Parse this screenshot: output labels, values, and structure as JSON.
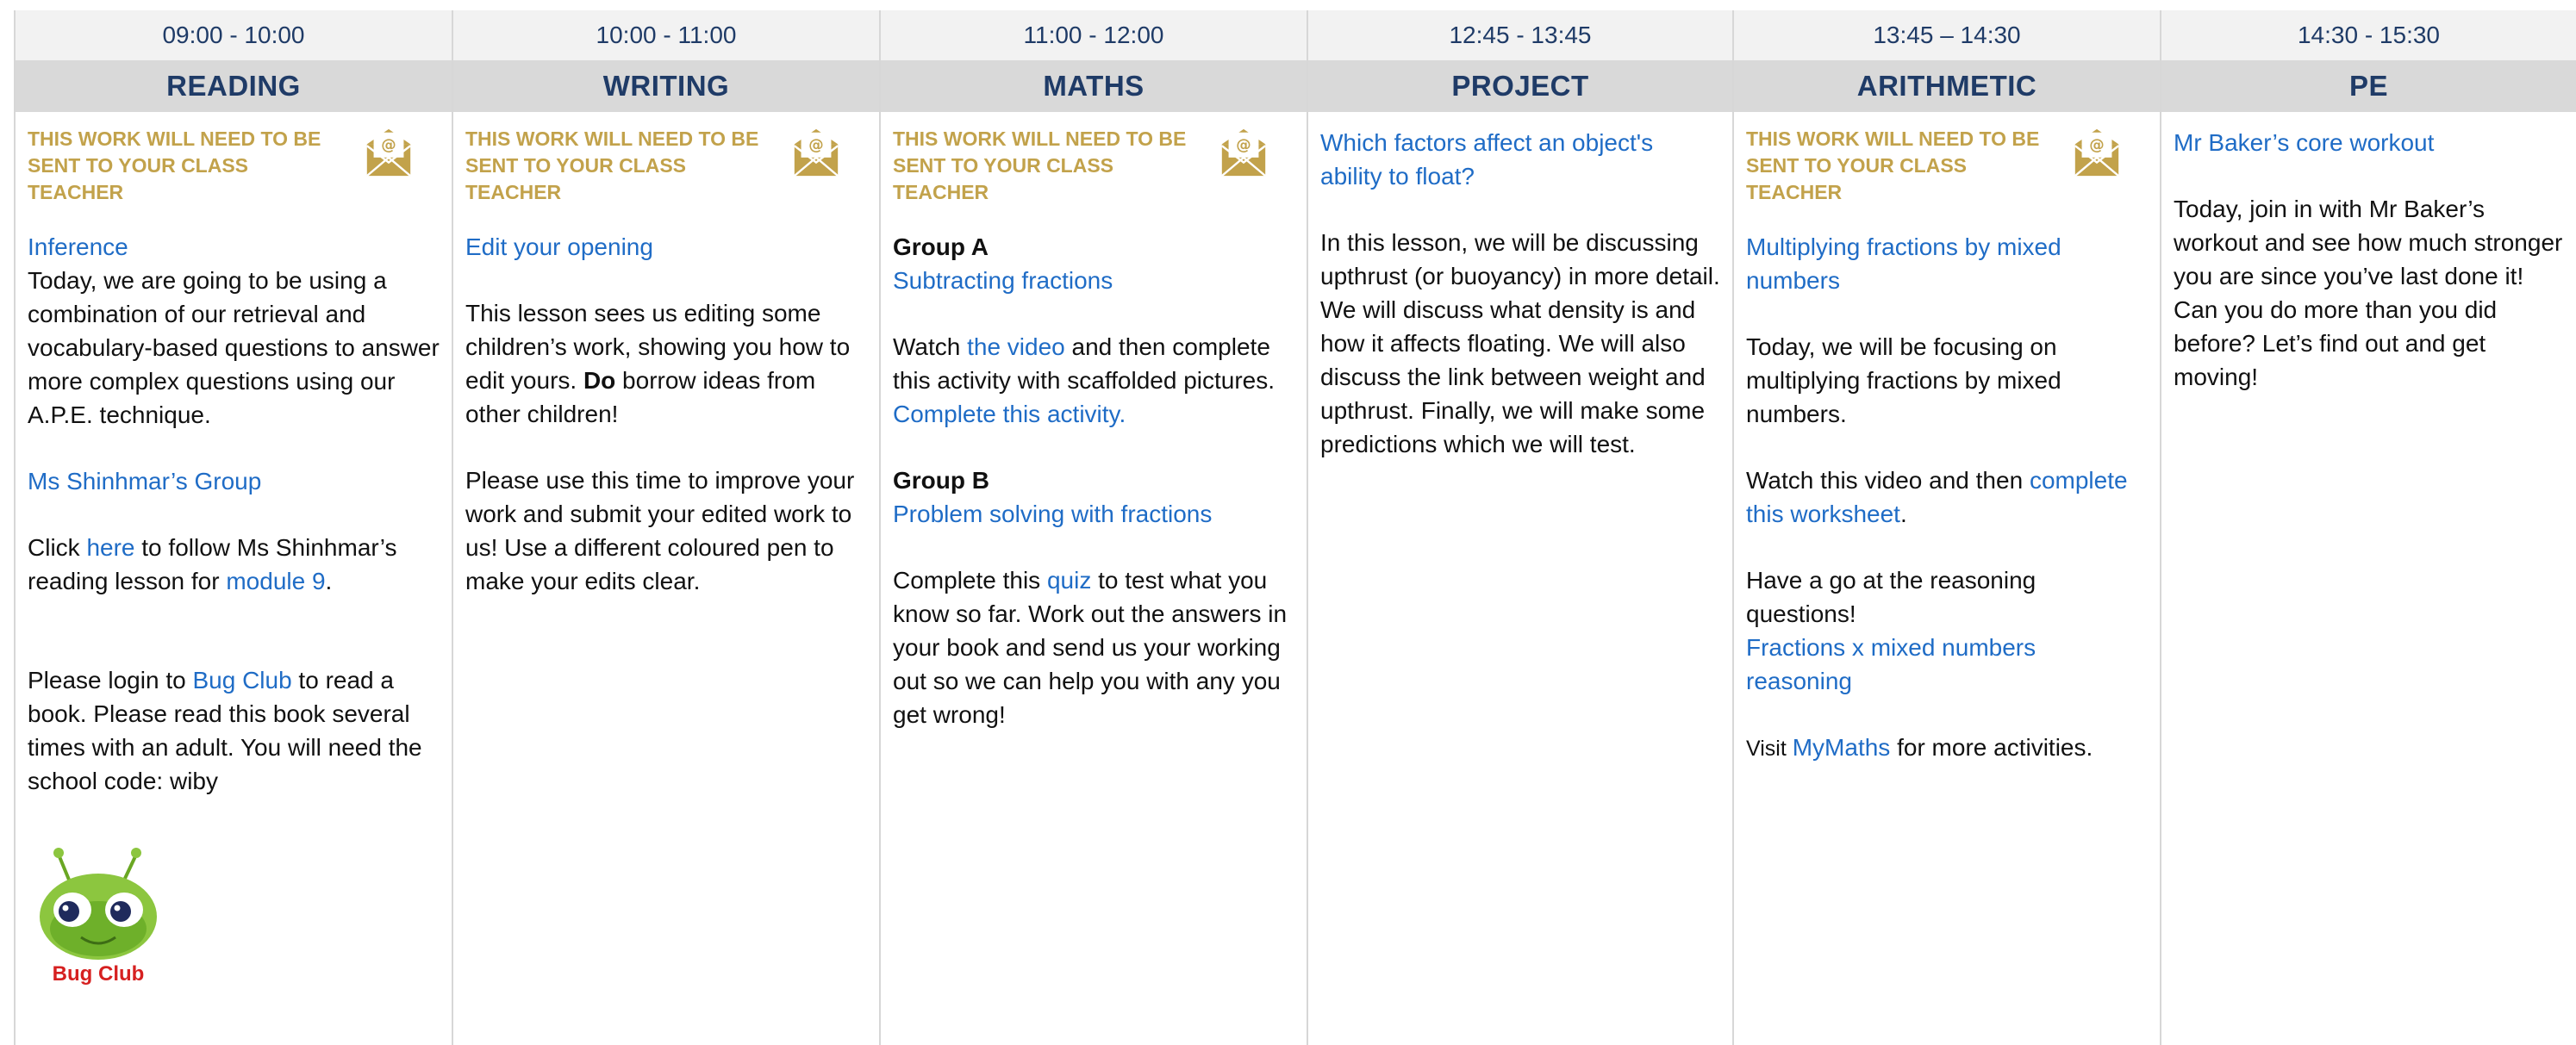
{
  "notice_text": "THIS WORK WILL NEED TO BE SENT TO YOUR CLASS TEACHER",
  "columns": [
    {
      "time": "09:00 - 10:00",
      "subject": "READING",
      "title": "Inference",
      "intro": "Today, we are going to be using a combination of our retrieval and vocabulary-based questions to answer more complex questions using our A.P.E. technique.",
      "group_link": "Ms Shinhmar’s Group",
      "click_pre": "Click ",
      "click_link": "here",
      "click_mid": " to follow Ms Shinhmar’s reading lesson for ",
      "click_link2": "module 9",
      "click_end": ".",
      "login_pre": "Please login to ",
      "login_link": "Bug Club",
      "login_end": " to read a book. Please read this book several times with an adult. You will need the school code: wiby",
      "logo_text": "Bug Club"
    },
    {
      "time": "10:00 - 11:00",
      "subject": "WRITING",
      "title": "Edit your opening",
      "p1": "This lesson sees us editing some children’s work, showing you how to edit yours. ",
      "p1_bold": "Do",
      "p1_end": " borrow ideas from other children!",
      "p2": "Please use this time to improve your work and submit your edited work to us! Use a different coloured pen to make your edits clear."
    },
    {
      "time": "11:00 - 12:00",
      "subject": "MATHS",
      "group_a": "Group A",
      "a_link": "Subtracting fractions",
      "watch_pre": "Watch ",
      "watch_link": "the video",
      "watch_end": " and then complete this activity with scaffolded pictures.",
      "complete_link": "Complete this activity.",
      "group_b": "Group B",
      "b_link": "Problem solving with fractions",
      "quiz_pre": "Complete this ",
      "quiz_link": "quiz",
      "quiz_end": " to test what you know so far. Work out the answers in your book and send us your working out so we can help you with any you get wrong!"
    },
    {
      "time": "12:45 - 13:45",
      "subject": "PROJECT",
      "title": "Which factors affect an object's ability to float?",
      "p1": "In this lesson, we will be discussing upthrust (or buoyancy) in more detail. We will discuss what density is and how it affects floating. We will also discuss the link between weight and upthrust. Finally, we will make some predictions which we will test."
    },
    {
      "time": "13:45 – 14:30",
      "subject": "ARITHMETIC",
      "title": "Multiplying fractions by mixed numbers",
      "p1": "Today, we will be focusing on multiplying fractions by mixed numbers.",
      "watch_pre": "Watch this video and then ",
      "watch_link": "complete this worksheet",
      "watch_end": ".",
      "reason": "Have a go at the reasoning questions!",
      "reason_link": "Fractions x mixed numbers reasoning",
      "visit_pre": "Visit ",
      "visit_link": "MyMaths",
      "visit_end": " for more activities."
    },
    {
      "time": "14:30 - 15:30",
      "subject": "PE",
      "title": "Mr Baker’s core workout",
      "p1": "Today, join in with Mr Baker’s workout and see how much stronger you are since you’ve last done it! Can you do more than you did before? Let’s find out and get moving!"
    }
  ]
}
